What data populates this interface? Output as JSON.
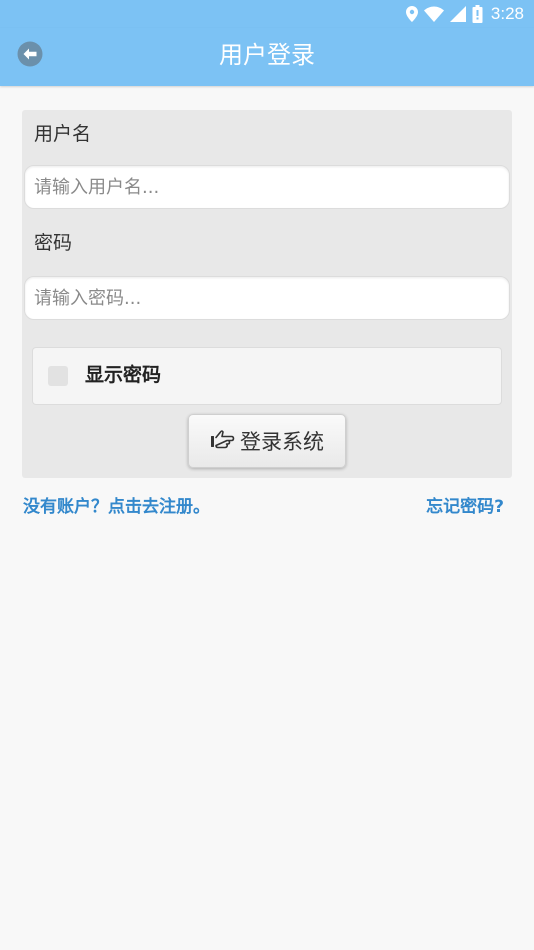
{
  "status_bar": {
    "time": "3:28",
    "icons": [
      "location-icon",
      "wifi-icon",
      "signal-icon",
      "battery-icon"
    ]
  },
  "app_bar": {
    "title": "用户登录",
    "back_icon": "arrow-left-circle-icon"
  },
  "form": {
    "username": {
      "label": "用户名",
      "placeholder": "请输入用户名...",
      "value": ""
    },
    "password": {
      "label": "密码",
      "placeholder": "请输入密码...",
      "value": ""
    },
    "show_password": {
      "label": "显示密码",
      "checked": false
    },
    "login_button": {
      "label": "登录系统",
      "icon": "hand-pointing-icon"
    }
  },
  "links": {
    "register": "没有账户？点击去注册。",
    "forgot_password": "忘记密码?"
  },
  "colors": {
    "primary": "#7cc2f4",
    "link": "#3388cc",
    "card_background": "#e8e8e8",
    "page_background": "#f8f8f8"
  }
}
